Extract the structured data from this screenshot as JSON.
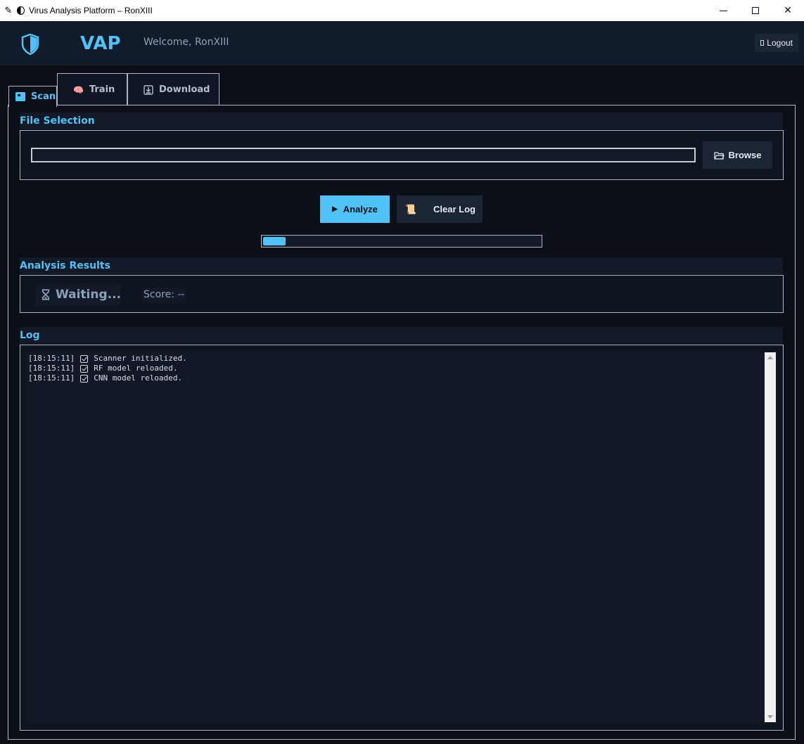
{
  "window": {
    "title": "Virus Analysis Platform – RonXIII",
    "controls": [
      "minimize",
      "maximize",
      "close"
    ]
  },
  "header": {
    "brand": "VAP",
    "welcome": "Welcome, RonXIII",
    "logout_label": "Logout",
    "accent_color": "#4fc3f7"
  },
  "tabs": [
    {
      "label": "Scan",
      "icon": "scan-icon",
      "active": true
    },
    {
      "label": "Train",
      "icon": "brain-icon",
      "active": false
    },
    {
      "label": "Download",
      "icon": "download-icon",
      "active": false
    }
  ],
  "file_selection": {
    "title": "File Selection",
    "path_value": "",
    "browse_label": "Browse"
  },
  "actions": {
    "analyze_label": "Analyze",
    "clear_log_label": "Clear Log"
  },
  "progress": {
    "fraction": 0.08
  },
  "results": {
    "title": "Analysis Results",
    "status": "Waiting...",
    "score": "Score: --"
  },
  "log": {
    "title": "Log",
    "entries": [
      {
        "time": "[18:15:11]",
        "message": "Scanner initialized."
      },
      {
        "time": "[18:15:11]",
        "message": "RF model reloaded."
      },
      {
        "time": "[18:15:11]",
        "message": "CNN model reloaded."
      }
    ]
  }
}
